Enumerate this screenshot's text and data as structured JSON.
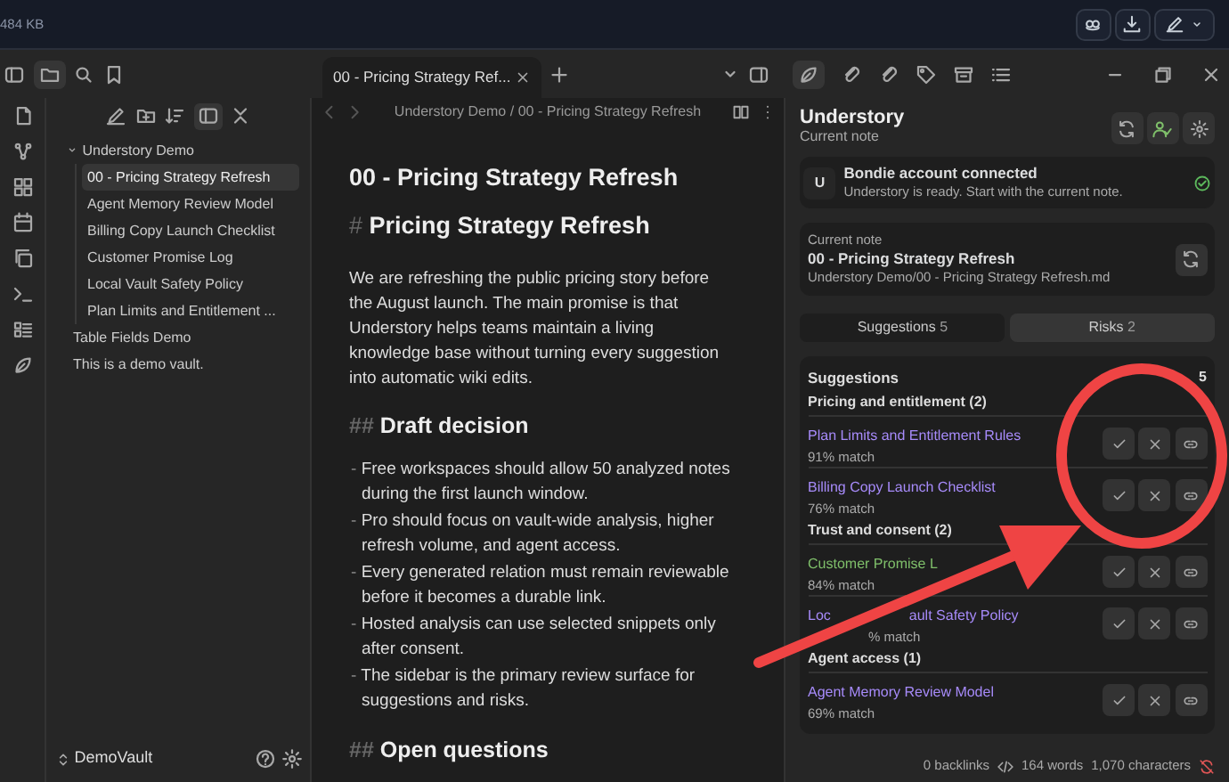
{
  "top_bar": {
    "file_size": "484 KB"
  },
  "tabs": [
    {
      "label": "00 - Pricing Strategy Ref...",
      "selected": true
    }
  ],
  "file_tree": [
    {
      "label": "Understory Demo",
      "expanded": true,
      "children": [
        {
          "label": "00 - Pricing Strategy Refresh",
          "selected": true
        },
        {
          "label": "Agent Memory Review Model",
          "selected": false
        },
        {
          "label": "Billing Copy Launch Checklist",
          "selected": false
        },
        {
          "label": "Customer Promise Log",
          "selected": false
        },
        {
          "label": "Local Vault Safety Policy",
          "selected": false
        },
        {
          "label": "Plan Limits and Entitlement ...",
          "selected": false
        }
      ]
    },
    {
      "label": "Table Fields Demo",
      "selected": false
    },
    {
      "label": "This is a demo vault.",
      "selected": false
    }
  ],
  "vault": {
    "name": "DemoVault"
  },
  "editor": {
    "breadcrumb": {
      "folder": "Understory Demo",
      "separator": "/",
      "note": "00 - Pricing Strategy Refresh"
    },
    "title": "00 - Pricing Strategy Refresh",
    "blocks": [
      {
        "kind": "heading1",
        "marker": "#",
        "text": "Pricing Strategy Refresh"
      },
      {
        "kind": "paragraph",
        "text": "We are refreshing the public pricing story before the August launch. The main promise is that Understory helps teams maintain a living knowledge base without turning every suggestion into automatic wiki edits."
      },
      {
        "kind": "heading2",
        "marker": "##",
        "text": "Draft decision"
      },
      {
        "kind": "bullet",
        "marker": "-",
        "text": "Free workspaces should allow 50 analyzed notes during the first launch window."
      },
      {
        "kind": "bullet",
        "marker": "-",
        "text": "Pro should focus on vault-wide analysis, higher refresh volume, and agent access."
      },
      {
        "kind": "bullet",
        "marker": "-",
        "text": "Every generated relation must remain reviewable before it becomes a durable link."
      },
      {
        "kind": "bullet",
        "marker": "-",
        "text": "Hosted analysis can use selected snippets only after consent."
      },
      {
        "kind": "bullet",
        "marker": "-",
        "text": "The sidebar is the primary review surface for suggestions and risks."
      },
      {
        "kind": "heading2",
        "marker": "##",
        "text": "Open questions"
      }
    ]
  },
  "panel": {
    "title": "Understory",
    "subtitle": "Current note",
    "account": {
      "avatar": "U",
      "title": "Bondie account connected",
      "message": "Understory is ready. Start with the current note.",
      "connected": true
    },
    "current_note": {
      "label": "Current note",
      "title": "00 - Pricing Strategy Refresh",
      "path": "Understory Demo/00 - Pricing Strategy Refresh.md"
    },
    "segments": [
      {
        "label": "Suggestions",
        "count": "5",
        "selected": false
      },
      {
        "label": "Risks",
        "count": "2",
        "selected": true
      }
    ],
    "suggestions": {
      "title": "Suggestions",
      "count": "5",
      "groups": [
        {
          "label": "Pricing and entitlement (2)",
          "items": [
            {
              "title": "Plan Limits and Entitlement Rules",
              "match": "91% match",
              "color": "#a78bfa"
            },
            {
              "title": "Billing Copy Launch Checklist",
              "match": "76% match",
              "color": "#a78bfa"
            }
          ]
        },
        {
          "label": "Trust and consent (2)",
          "items": [
            {
              "title": "Customer Promise L",
              "match": "84% match",
              "color": "#7fbf6a"
            },
            {
              "title": "Loc",
              "title_rest": "ault Safety Policy",
              "match": "% match",
              "color": "#a78bfa"
            }
          ]
        },
        {
          "label": "Agent access (1)",
          "items": [
            {
              "title": "Agent Memory Review Model",
              "match": "69% match",
              "color": "#a78bfa"
            }
          ]
        }
      ]
    }
  },
  "status_bar": {
    "backlinks": "0 backlinks",
    "words": "164 words",
    "characters": "1,070 characters"
  }
}
